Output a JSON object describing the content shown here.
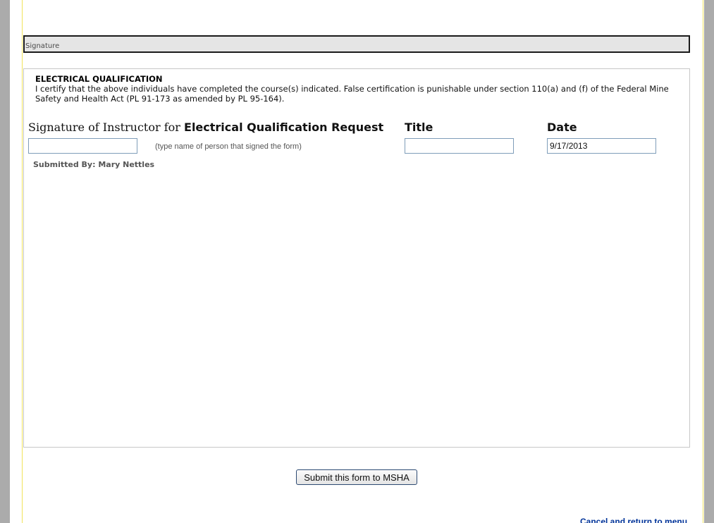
{
  "signature_section": {
    "header_label": "Signature"
  },
  "electrical_qualification": {
    "title": "ELECTRICAL QUALIFICATION",
    "certification_text": "I certify that the above individuals have completed the course(s) indicated. False certification is punishable under section 110(a) and (f) of the Federal Mine Safety and Health Act (PL 91-173 as amended by PL 95-164)."
  },
  "form": {
    "instructor_label_prefix": "Signature of Instructor for",
    "instructor_label_strong": "Electrical Qualification Request",
    "instructor_value": "",
    "instructor_hint": "(type name of person that signed the form)",
    "title_label": "Title",
    "title_value": "",
    "date_label": "Date",
    "date_value": "9/17/2013",
    "submitted_by": "Submitted By: Mary Nettles"
  },
  "actions": {
    "submit_label": "Submit this form to MSHA",
    "cancel_label": "Cancel and return to menu"
  },
  "colors": {
    "link": "#003399",
    "page_bg": "#ababab",
    "header_bg": "#e5e5e5"
  }
}
